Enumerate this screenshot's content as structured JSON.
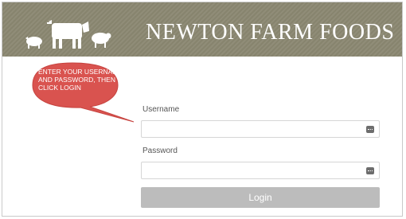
{
  "header": {
    "brand": "NEWTON FARM FOODS",
    "background_color": "#8b8872"
  },
  "callout": {
    "text": "ENTER YOUR USERNAME AND PASSWORD, THEN CLICK LOGIN",
    "color": "#d9534f"
  },
  "form": {
    "username_label": "Username",
    "username_value": "",
    "password_label": "Password",
    "password_value": "",
    "login_label": "Login"
  },
  "icons": {
    "animals": [
      "pig-icon",
      "cow-icon",
      "sheep-icon"
    ],
    "field_icon": "password-manager-key-icon"
  }
}
